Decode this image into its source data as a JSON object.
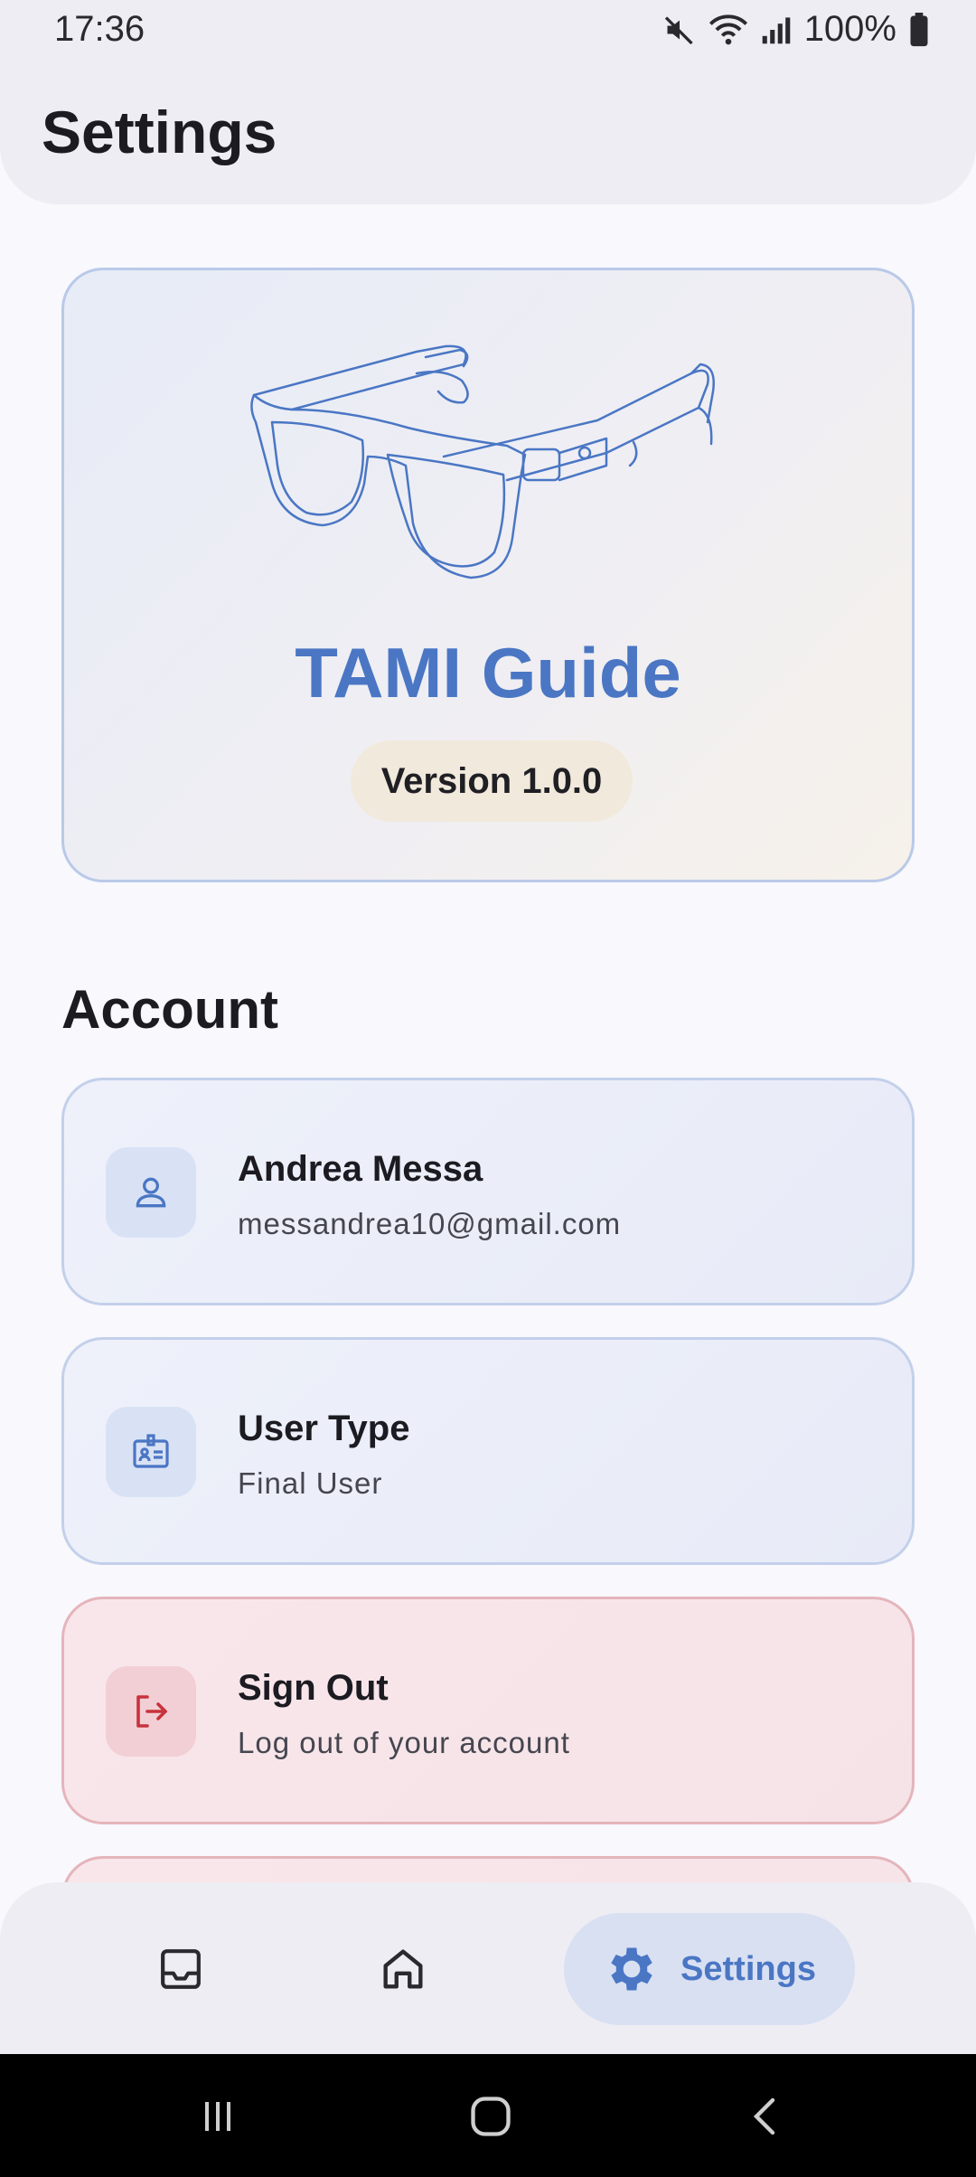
{
  "status_bar": {
    "time": "17:36",
    "battery_percent": "100%"
  },
  "header": {
    "title": "Settings"
  },
  "hero": {
    "app_name": "TAMI Guide",
    "version": "Version 1.0.0"
  },
  "account": {
    "section_title": "Account",
    "items": [
      {
        "title": "Andrea Messa",
        "subtitle": "messandrea10@gmail.com",
        "icon": "person-icon"
      },
      {
        "title": "User Type",
        "subtitle": "Final User",
        "icon": "id-badge-icon"
      },
      {
        "title": "Sign Out",
        "subtitle": "Log out of your account",
        "icon": "logout-icon"
      }
    ]
  },
  "bottom_nav": {
    "items": [
      {
        "icon": "inbox-icon"
      },
      {
        "icon": "home-icon"
      },
      {
        "icon": "gear-icon",
        "label": "Settings",
        "active": true
      }
    ]
  },
  "colors": {
    "accent": "#4a76c4",
    "danger": "#c8323c",
    "chip": "#f1e9db"
  }
}
